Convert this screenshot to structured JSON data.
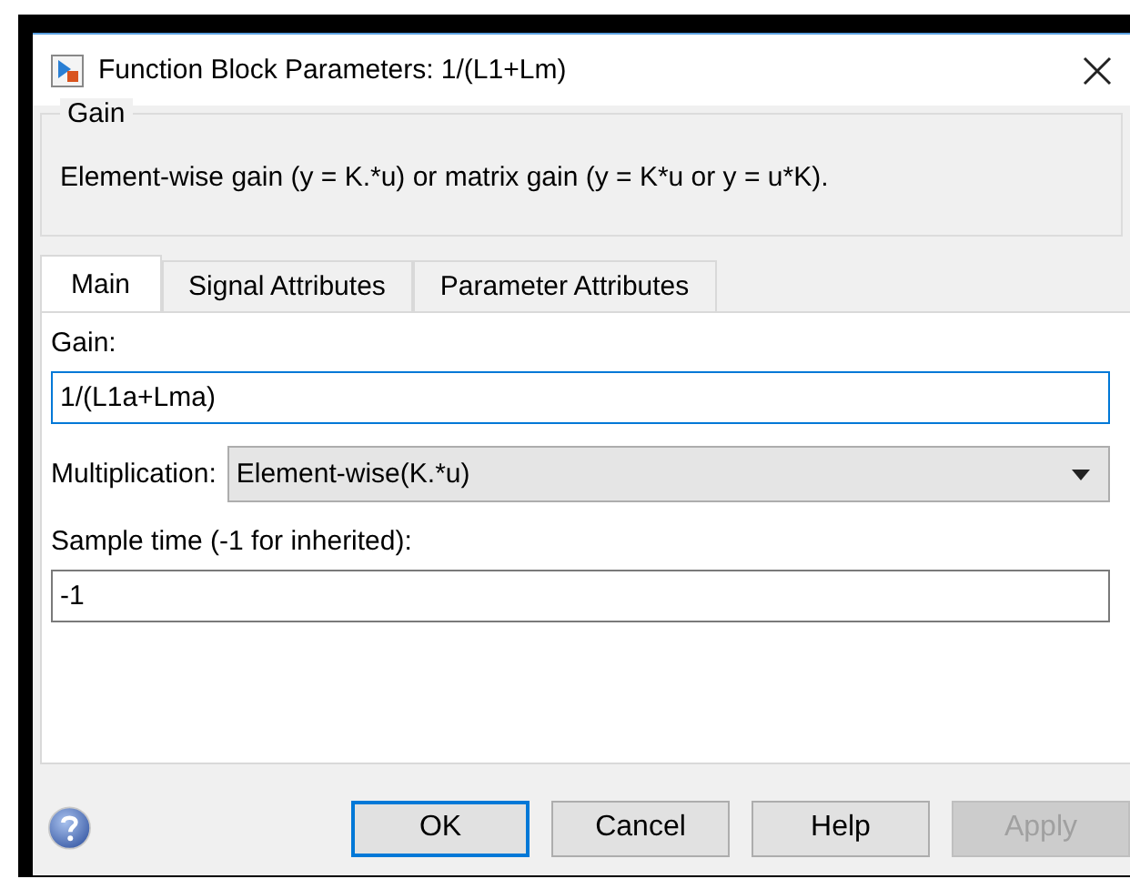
{
  "window": {
    "title": "Function Block Parameters: 1/(L1+Lm)"
  },
  "group": {
    "title": "Gain",
    "description": "Element-wise gain (y = K.*u) or matrix gain (y = K*u or y = u*K)."
  },
  "tabs": [
    {
      "label": "Main",
      "selected": true
    },
    {
      "label": "Signal Attributes",
      "selected": false
    },
    {
      "label": "Parameter Attributes",
      "selected": false
    }
  ],
  "fields": [
    {
      "kind": "text",
      "label": "Gain:",
      "value": "1/(L1a+Lma)",
      "focused": true
    },
    {
      "kind": "dropdown",
      "label": "Multiplication:",
      "value": "Element-wise(K.*u)"
    },
    {
      "kind": "text",
      "label": "Sample time (-1 for inherited):",
      "value": "-1",
      "focused": false
    }
  ],
  "buttons": [
    {
      "label": "OK",
      "default": true,
      "disabled": false
    },
    {
      "label": "Cancel",
      "default": false,
      "disabled": false
    },
    {
      "label": "Help",
      "default": false,
      "disabled": false
    },
    {
      "label": "Apply",
      "default": false,
      "disabled": true
    }
  ]
}
